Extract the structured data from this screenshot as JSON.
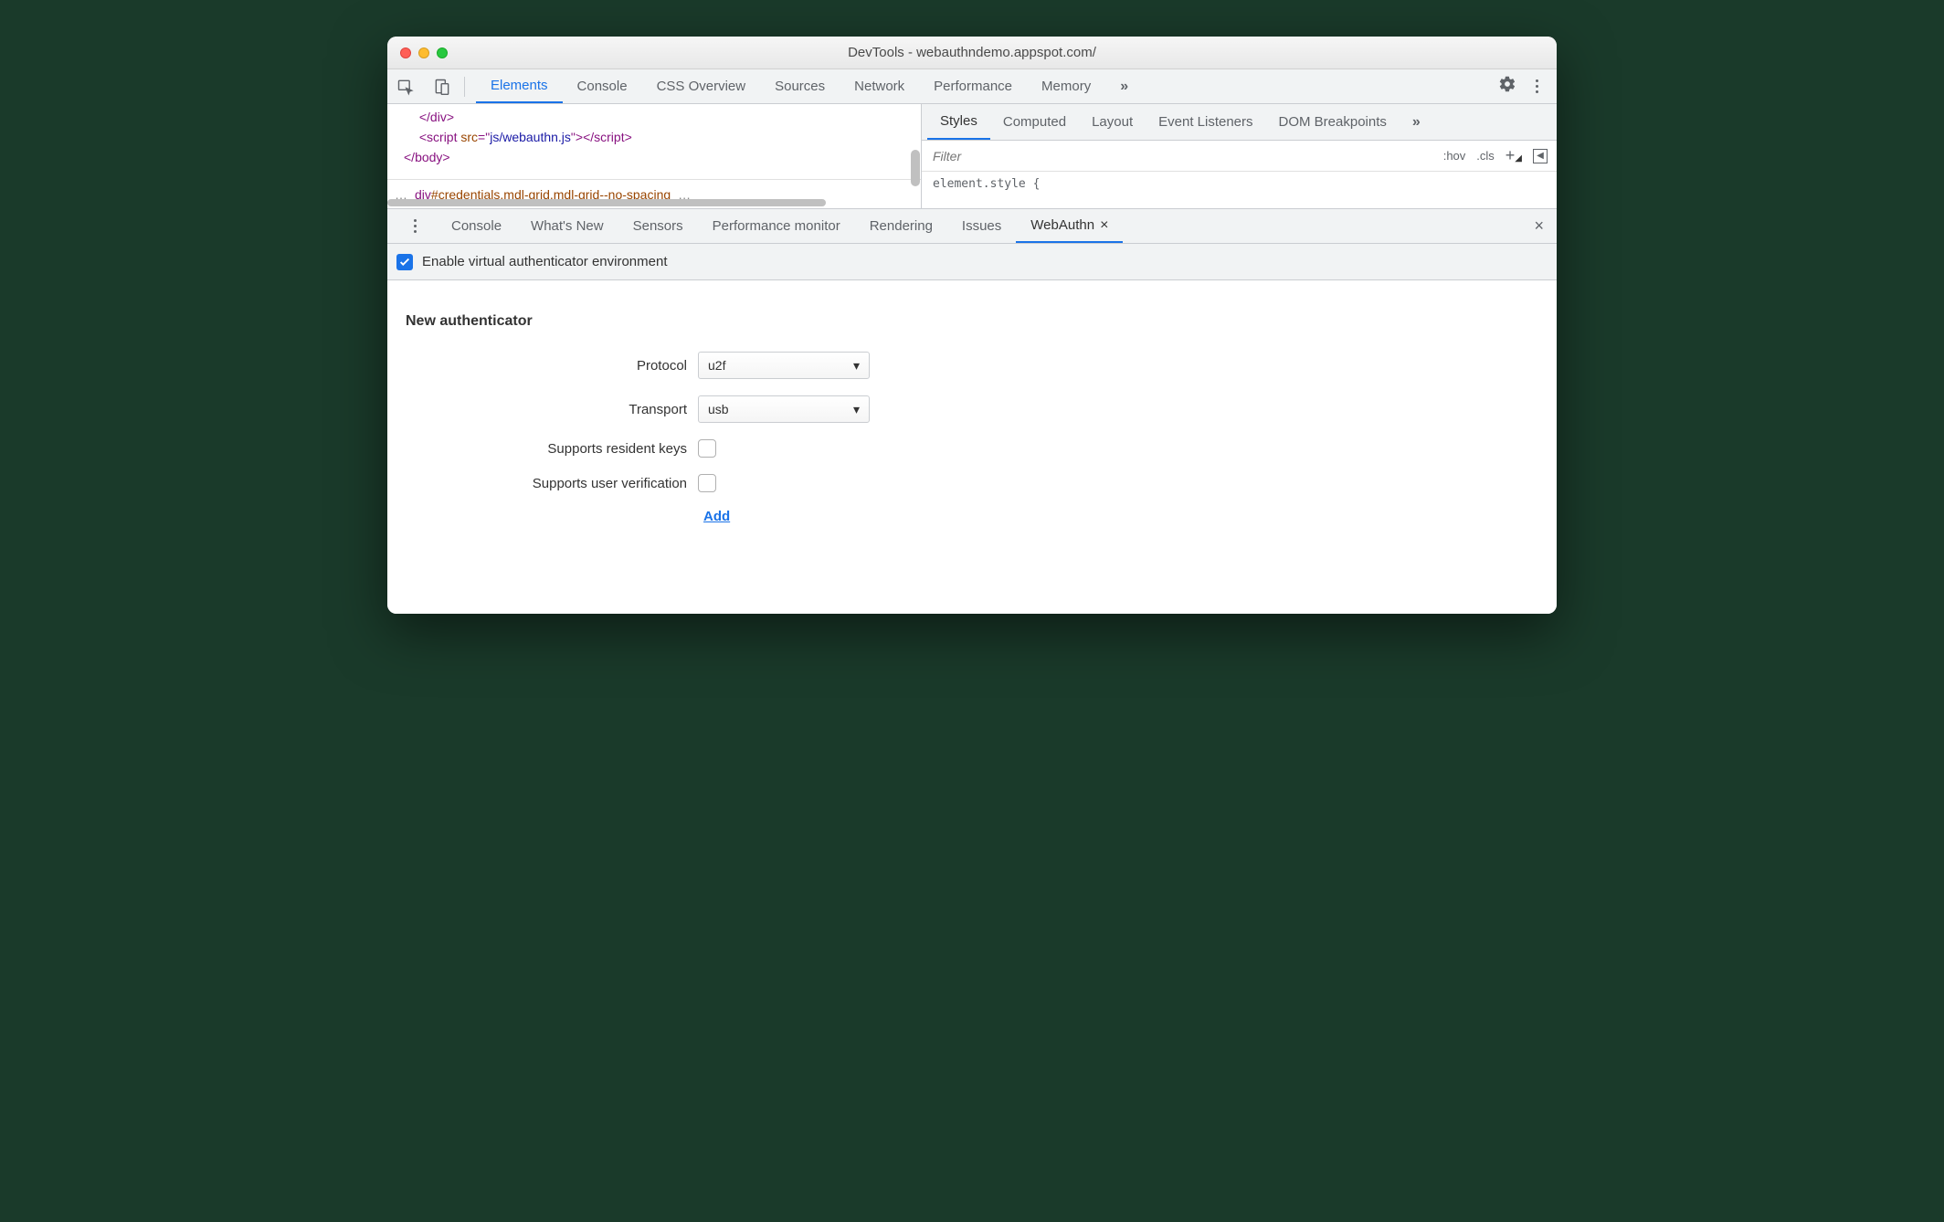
{
  "window": {
    "title": "DevTools - webauthndemo.appspot.com/"
  },
  "mainTabs": {
    "elements": "Elements",
    "console": "Console",
    "cssOverview": "CSS Overview",
    "sources": "Sources",
    "network": "Network",
    "performance": "Performance",
    "memory": "Memory"
  },
  "code": {
    "line1": "</div>",
    "line2a": "<script ",
    "line2b": "src",
    "line2c": "=\"",
    "line2d": "js/webauthn.js",
    "line2e": "\">",
    "line2f": "</script>",
    "line3": "</body>"
  },
  "breadcrumb": {
    "more": "…",
    "div": "div",
    "hash": "#credentials",
    "dot1": ".mdl-grid",
    "dot2": ".mdl-grid--no-spacing",
    "more2": "…"
  },
  "stylesTabs": {
    "styles": "Styles",
    "computed": "Computed",
    "layout": "Layout",
    "eventListeners": "Event Listeners",
    "domBreakpoints": "DOM Breakpoints"
  },
  "stylesFilter": {
    "placeholder": "Filter",
    "hov": ":hov",
    "cls": ".cls"
  },
  "stylesContent": "element.style {",
  "drawerTabs": {
    "console": "Console",
    "whatsnew": "What's New",
    "sensors": "Sensors",
    "perfmon": "Performance monitor",
    "rendering": "Rendering",
    "issues": "Issues",
    "webauthn": "WebAuthn"
  },
  "webauthn": {
    "enableLabel": "Enable virtual authenticator environment",
    "sectionTitle": "New authenticator",
    "protocolLabel": "Protocol",
    "protocolValue": "u2f",
    "transportLabel": "Transport",
    "transportValue": "usb",
    "residentKeysLabel": "Supports resident keys",
    "userVerificationLabel": "Supports user verification",
    "addLabel": "Add"
  }
}
